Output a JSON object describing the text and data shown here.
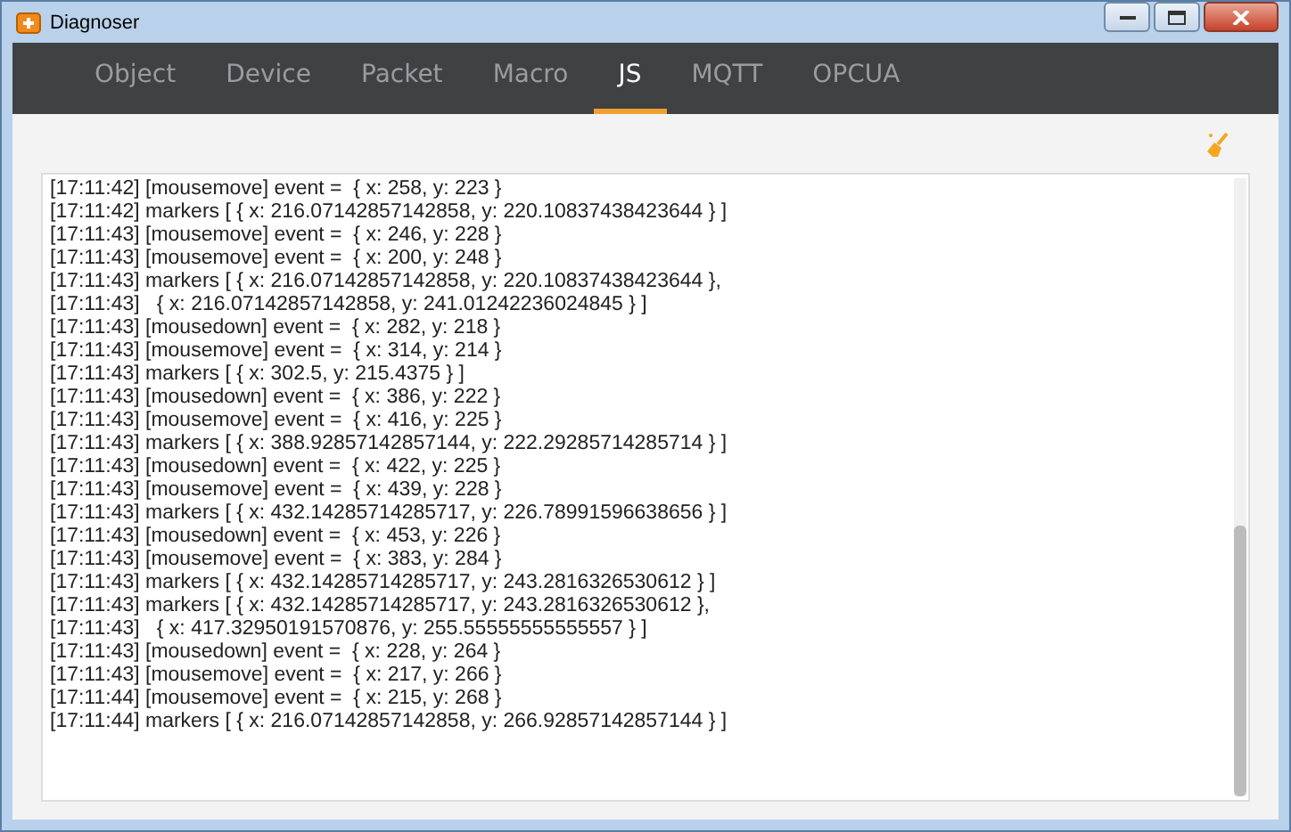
{
  "window": {
    "title": "Diagnoser"
  },
  "tabs": [
    {
      "label": "Object",
      "selected": false
    },
    {
      "label": "Device",
      "selected": false
    },
    {
      "label": "Packet",
      "selected": false
    },
    {
      "label": "Macro",
      "selected": false
    },
    {
      "label": "JS",
      "selected": true
    },
    {
      "label": "MQTT",
      "selected": false
    },
    {
      "label": "OPCUA",
      "selected": false
    }
  ],
  "log": [
    "[17:11:42] [mousemove] event =  { x: 258, y: 223 }",
    "[17:11:42] markers [ { x: 216.07142857142858, y: 220.10837438423644 } ]",
    "[17:11:43] [mousemove] event =  { x: 246, y: 228 }",
    "[17:11:43] [mousemove] event =  { x: 200, y: 248 }",
    "[17:11:43] markers [ { x: 216.07142857142858, y: 220.10837438423644 },",
    "[17:11:43]   { x: 216.07142857142858, y: 241.01242236024845 } ]",
    "[17:11:43] [mousedown] event =  { x: 282, y: 218 }",
    "[17:11:43] [mousemove] event =  { x: 314, y: 214 }",
    "[17:11:43] markers [ { x: 302.5, y: 215.4375 } ]",
    "[17:11:43] [mousedown] event =  { x: 386, y: 222 }",
    "[17:11:43] [mousemove] event =  { x: 416, y: 225 }",
    "[17:11:43] markers [ { x: 388.92857142857144, y: 222.29285714285714 } ]",
    "[17:11:43] [mousedown] event =  { x: 422, y: 225 }",
    "[17:11:43] [mousemove] event =  { x: 439, y: 228 }",
    "[17:11:43] markers [ { x: 432.14285714285717, y: 226.78991596638656 } ]",
    "[17:11:43] [mousedown] event =  { x: 453, y: 226 }",
    "[17:11:43] [mousemove] event =  { x: 383, y: 284 }",
    "[17:11:43] markers [ { x: 432.14285714285717, y: 243.2816326530612 } ]",
    "[17:11:43] markers [ { x: 432.14285714285717, y: 243.2816326530612 },",
    "[17:11:43]   { x: 417.32950191570876, y: 255.55555555555557 } ]",
    "[17:11:43] [mousedown] event =  { x: 228, y: 264 }",
    "[17:11:43] [mousemove] event =  { x: 217, y: 266 }",
    "[17:11:44] [mousemove] event =  { x: 215, y: 268 }",
    "[17:11:44] markers [ { x: 216.07142857142858, y: 266.92857142857144 } ]"
  ]
}
